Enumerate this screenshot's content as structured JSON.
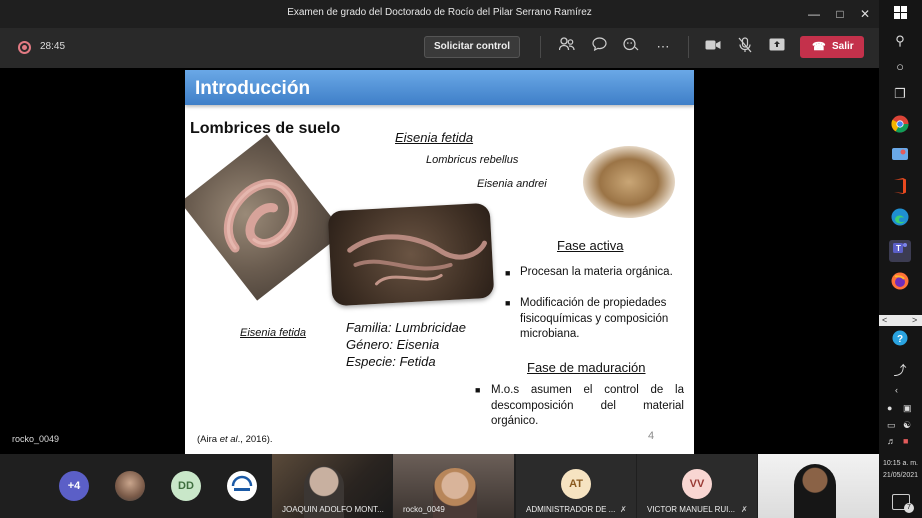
{
  "window": {
    "title": "Examen de grado del Doctorado de Rocío del Pilar Serrano Ramírez"
  },
  "toolbar": {
    "timer": "28:45",
    "control_label": "Solicitar control",
    "leave_label": "Salir"
  },
  "slide": {
    "header": "Introducción",
    "subtitle": "Lombrices de suelo",
    "species": [
      "Eisenia fetida",
      "Lombricus rebellus",
      "Eisenia andrei"
    ],
    "photo_caption": "Eisenia fetida",
    "taxonomy": [
      "Familia: Lumbricidae",
      "Género: Eisenia",
      "Especie: Fetida"
    ],
    "active_phase": {
      "heading": "Fase activa",
      "bullets": [
        "Procesan la materia orgánica.",
        "Modificación de propiedades fisicoquímicas y composición microbiana."
      ]
    },
    "maturation_phase": {
      "heading": "Fase de maduración",
      "bullet": "M.o.s asumen el control de la descomposición del material orgánico."
    },
    "citation_prefix": "(Aira ",
    "citation_italic": "et al",
    "citation_suffix": "., 2016).",
    "page_number": "4"
  },
  "presenter_name": "rocko_0049",
  "participants": {
    "overflow_count": "+4",
    "initials_dd": "DD",
    "tiles": [
      {
        "name": "JOAQUIN ADOLFO MONT..."
      },
      {
        "name": "rocko_0049"
      },
      {
        "initials": "AT",
        "name": "ADMINISTRADOR DE ..."
      },
      {
        "initials": "VV",
        "name": "VICTOR MANUEL RUI..."
      }
    ]
  },
  "taskbar": {
    "time": "10:15 a. m.",
    "date": "21/05/2021",
    "notification_count": "7"
  },
  "colors": {
    "leave_button": "#c4314b",
    "slide_header": "#4a8bd6",
    "avatar_dd": "#c9e7c9",
    "avatar_at": "#f6e3c1",
    "avatar_vv": "#f8d6d2"
  }
}
